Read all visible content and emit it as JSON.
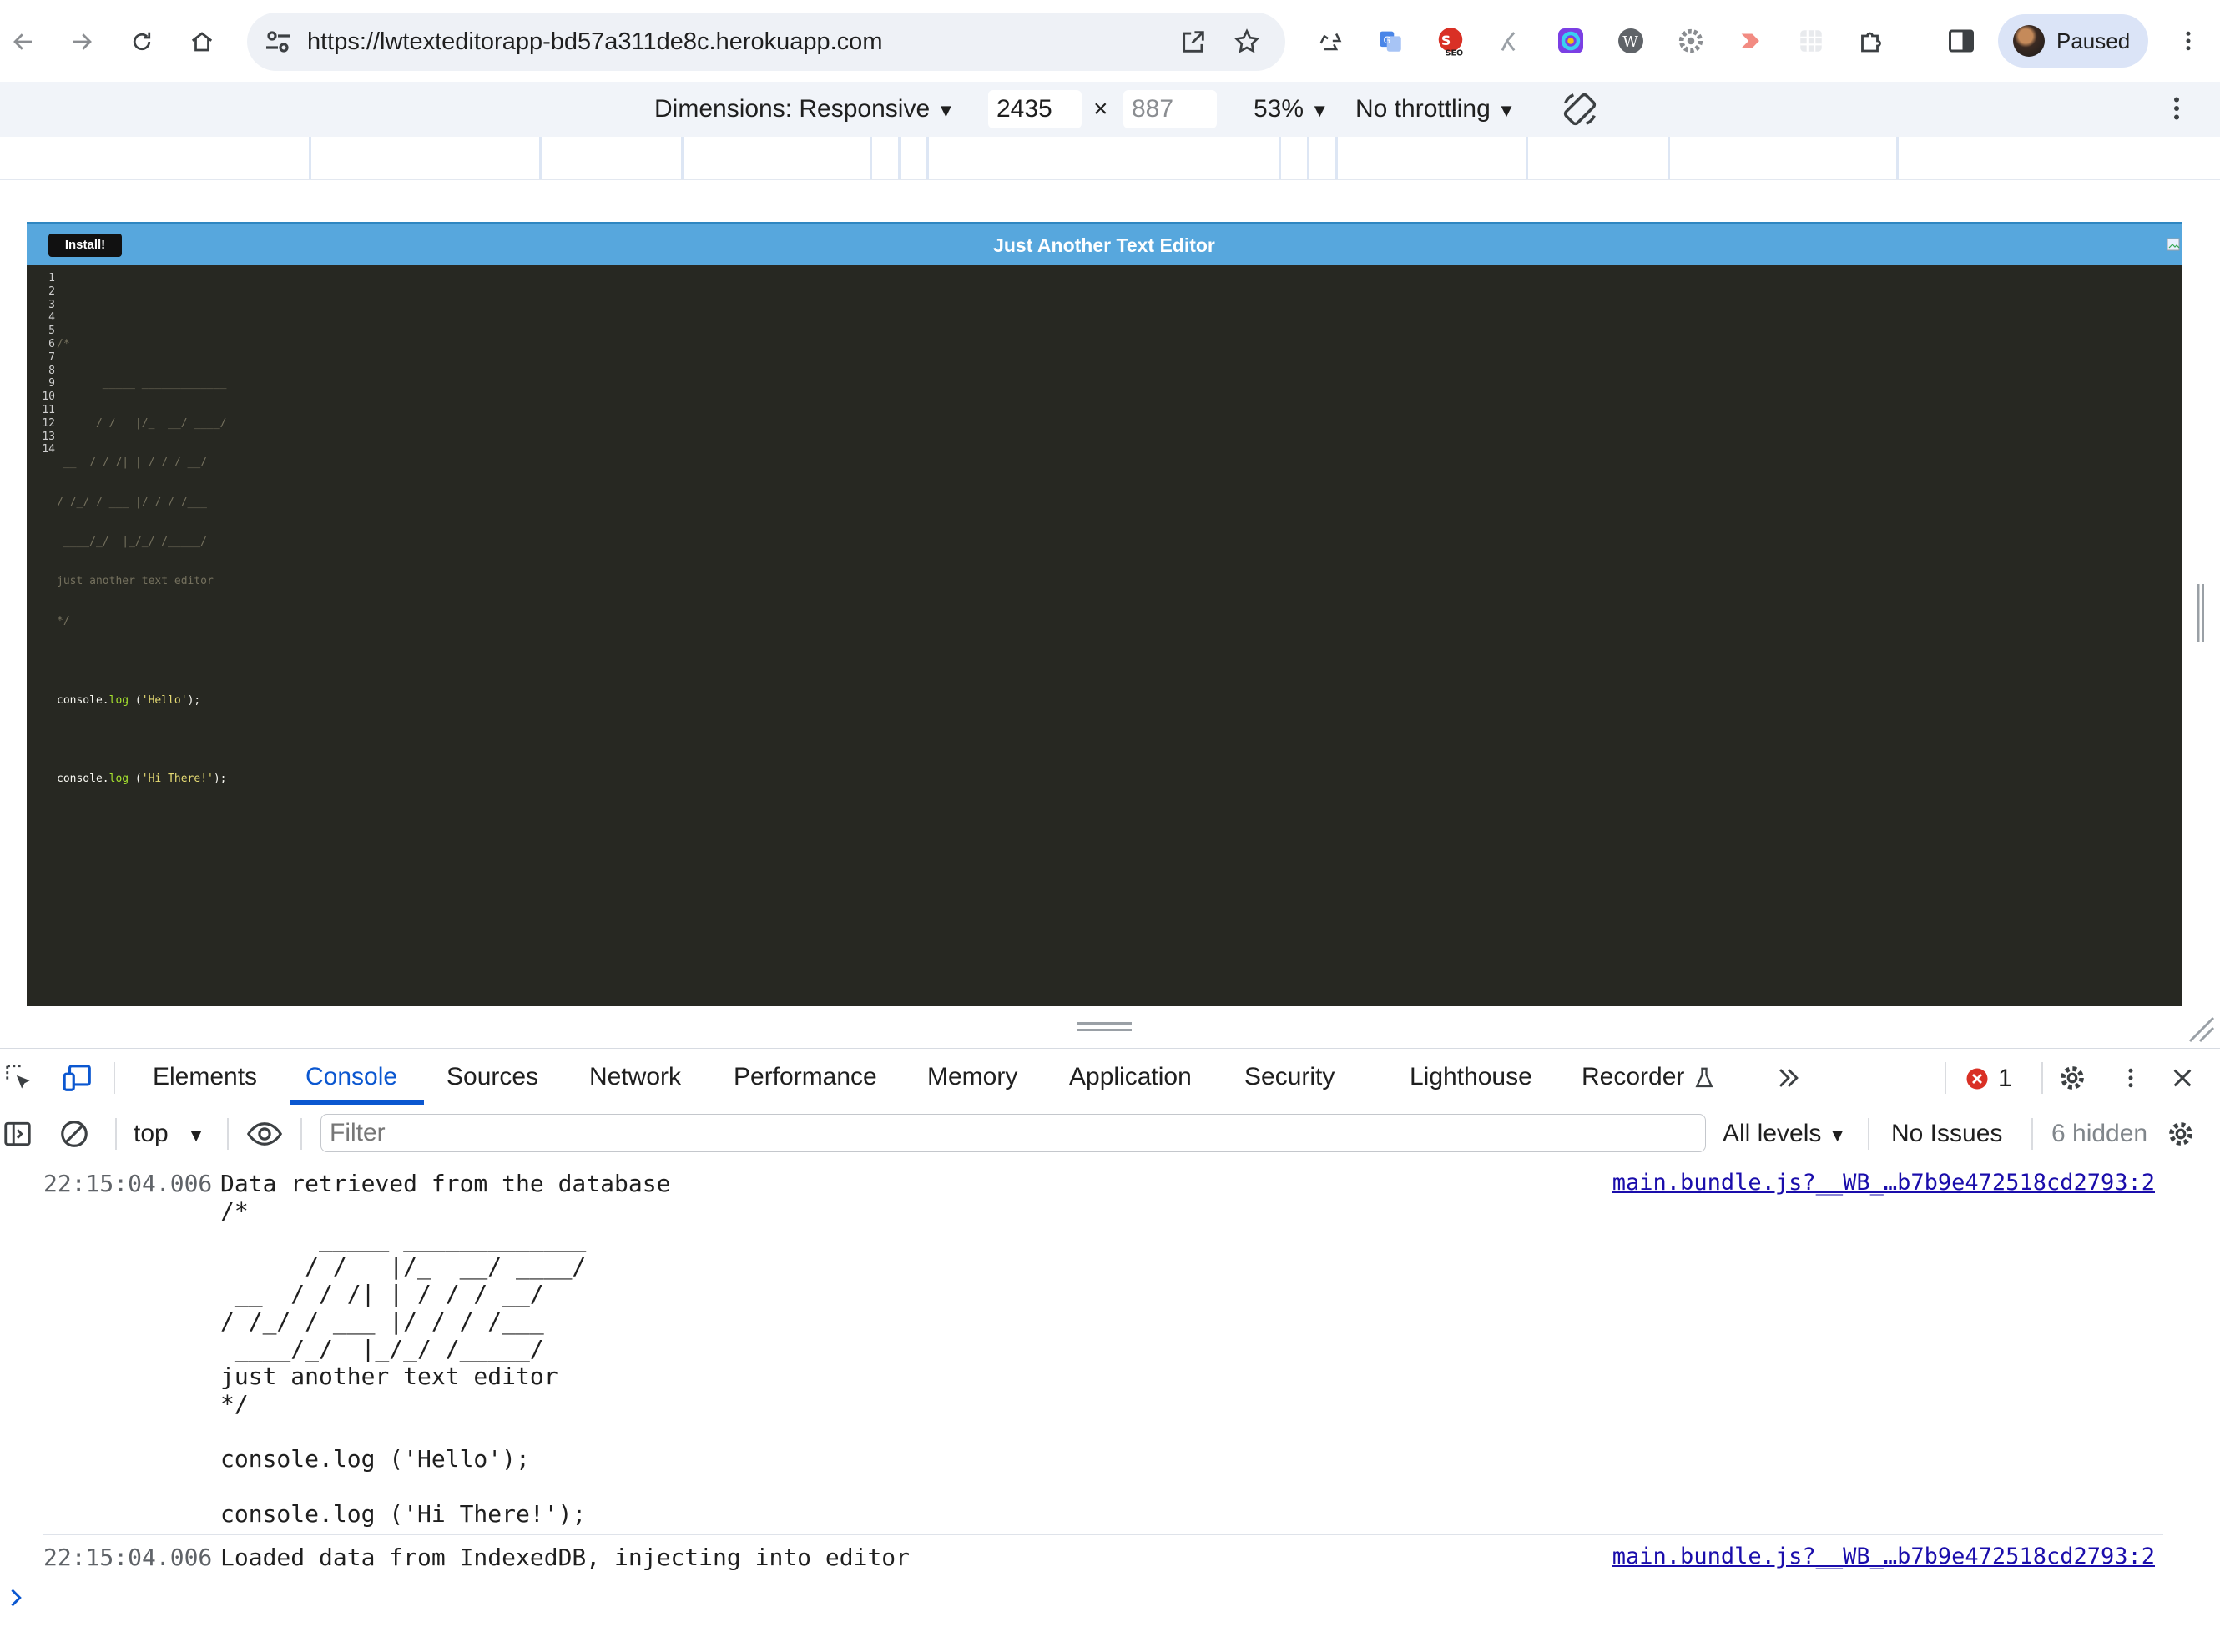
{
  "browser": {
    "url": "https://lwtexteditorapp-bd57a311de8c.herokuapp.com",
    "profile_label": "Paused",
    "extensions": [
      "recycle-icon",
      "translate-icon",
      "seo-icon",
      "pen-icon",
      "colorzilla-icon",
      "wordpress-icon",
      "gear-extension-icon",
      "arrow-extension-icon",
      "grid-extension-icon",
      "puzzle-icon"
    ]
  },
  "device_toolbar": {
    "dimensions_label": "Dimensions: Responsive",
    "width": "2435",
    "times": "×",
    "height": "887",
    "zoom": "53%",
    "throttling": "No throttling"
  },
  "app": {
    "install_label": "Install!",
    "title": "Just Another Text Editor",
    "line_numbers": [
      "1",
      "2",
      "3",
      "4",
      "5",
      "6",
      "7",
      "8",
      "9",
      "10",
      "11",
      "12",
      "13",
      "14"
    ],
    "code": {
      "l2": "/*",
      "l3": "       _____ _____________",
      "l4": "      / /   |/_  __/ ____/",
      "l5": " __  / / /| | / / / __/",
      "l6": "/ /_/ / ___ |/ / / /___",
      "l7": " ____/_/  |_/_/ /_____/",
      "l8": "just another text editor",
      "l9": "*/",
      "l11_obj": "console.",
      "l11_fn": "log",
      "l11_open": " (",
      "l11_str": "'Hello'",
      "l11_close": ");",
      "l13_obj": "console.",
      "l13_fn": "log",
      "l13_open": " (",
      "l13_str": "'Hi There!'",
      "l13_close": ");"
    }
  },
  "devtools": {
    "tabs": [
      "Elements",
      "Console",
      "Sources",
      "Network",
      "Performance",
      "Memory",
      "Application",
      "Security",
      "Lighthouse",
      "Recorder"
    ],
    "active_tab": "Console",
    "error_count": "1",
    "context": "top",
    "filter_placeholder": "Filter",
    "levels": "All levels",
    "issues": "No Issues",
    "hidden": "6 hidden"
  },
  "console": {
    "entries": [
      {
        "time": "22:15:04.006",
        "message": "Data retrieved from the database\n/*\n       _____ _____________\n      / /   |/_  __/ ____/\n __  / / /| | / / / __/\n/ /_/ / ___ |/ / / /___\n ____/_/  |_/_/ /_____/\njust another text editor\n*/\n\nconsole.log ('Hello');\n\nconsole.log ('Hi There!');",
        "source": "main.bundle.js?__WB_…b7b9e472518cd2793:2"
      },
      {
        "time": "22:15:04.006",
        "message": "Loaded data from IndexedDB, injecting into editor",
        "source": "main.bundle.js?__WB_…b7b9e472518cd2793:2"
      }
    ]
  },
  "colors": {
    "header_blue": "#57a7dd",
    "editor_bg": "#272822",
    "accent_blue": "#0b57d0",
    "error_red": "#d93025"
  }
}
